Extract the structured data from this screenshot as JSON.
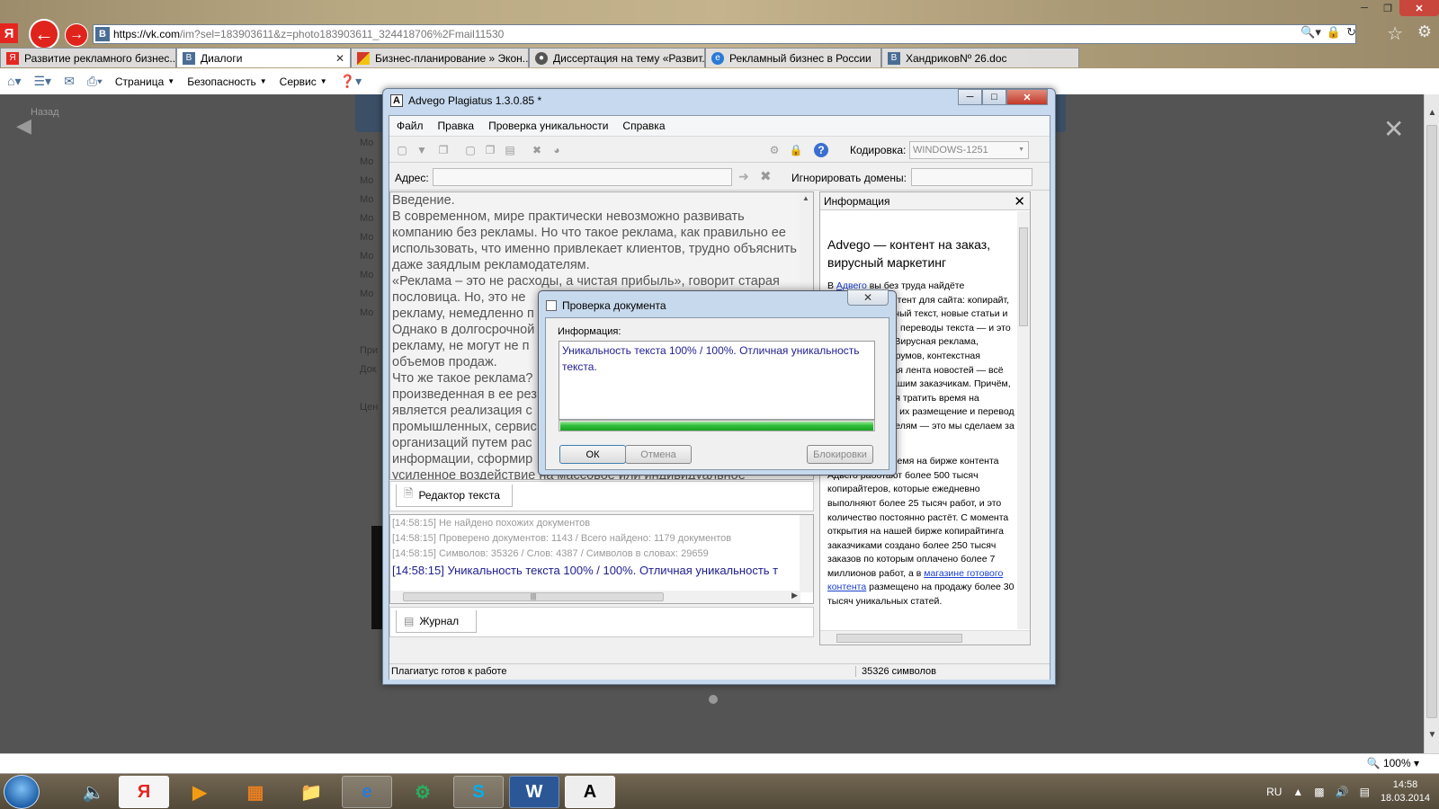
{
  "browser": {
    "url_main": "https://vk.com",
    "url_rest": "/im?sel=183903611&z=photo183903611_324418706%2Fmail11530",
    "tabs": [
      {
        "label": "Развитие рекламного бизнес...",
        "active": false,
        "icon": "yandex-icon",
        "color": "#e52620"
      },
      {
        "label": "Диалоги",
        "active": true,
        "icon": "vk-icon",
        "color": "#4a6d95"
      },
      {
        "label": "Бизнес-планирование » Экон...",
        "active": false,
        "icon": "flag-icon",
        "color": "#d43a2a"
      },
      {
        "label": "Диссертация на тему «Развит...",
        "active": false,
        "icon": "globe-icon",
        "color": "#555555"
      },
      {
        "label": "Рекламный бизнес в России",
        "active": false,
        "icon": "ie-icon",
        "color": "#2a7ad6"
      },
      {
        "label": "ХандриковNº 26.doc",
        "active": false,
        "icon": "vk-icon",
        "color": "#4a6d95"
      }
    ],
    "commands": {
      "page": "Страница",
      "security": "Безопасность",
      "service": "Сервис"
    },
    "zoom": "100%"
  },
  "vk_page": {
    "back": "Назад",
    "sidebar": [
      "Мо",
      "Мо",
      "Мо",
      "Мо",
      "Мо",
      "Мо",
      "Мо",
      "Мо",
      "Мо",
      "Мо",
      "",
      "При",
      "Док",
      "",
      "Цен"
    ]
  },
  "advego": {
    "title": "Advego Plagiatus 1.3.0.85 *",
    "menu": [
      "Файл",
      "Правка",
      "Проверка уникальности",
      "Справка"
    ],
    "encoding_label": "Кодировка:",
    "encoding_value": "WINDOWS-1251",
    "address_label": "Адрес:",
    "ignore_label": "Игнорировать домены:",
    "editor_text": "Введение.\nВ современном, мире практически невозможно развивать компанию без рекламы. Но что такое реклама, как правильно ее использовать, что именно привлекает клиентов, трудно объяснить даже заядлым рекламодателям.\n«Реклама – это не расходы, а чистая прибыль», говорит старая пословица. Но, это не\nрекламу, немедленно п\nОднако в долгосрочной\nрекламу, не могут не п\nобъемов продаж.\nЧто же такое реклама?\nпроизведенная в ее рез\nявляется реализация с\nпромышленных, сервис\nорганизаций путем рас\nинформации, сформир\nусиленное воздействие на массовое или индивидуальное",
    "editor_tab": "Редактор текста",
    "log": [
      "[14:58:15] Не найдено похожих документов",
      "[14:58:15] Проверено документов: 1143  /  Всего найдено: 1179 документов",
      "[14:58:15] Символов: 35326 / Слов: 4387 / Символов в словах: 29659",
      "[14:58:15] Уникальность текста 100% / 100%. Отличная уникальность т"
    ],
    "journal_tab": "Журнал",
    "info": {
      "header": "Информация",
      "headline": "Advego — контент на заказ, вирусный маркетинг",
      "para1_link": "Адвего",
      "para1": "вы без труда найдёте уникальный контент для сайта: копирайт, рерайт, рекламный текст, новые статьи и статьи на заказ, переводы текста — и это далеко не всё! Вирусная реклама, наполнение форумов, контекстная реклама, готовая лента новостей — всё это доступно нашим заказчикам. Причём, вам не придётся тратить время на проверку работ, их размещение и перевод денег исполнителям — это мы сделаем за вас.",
      "para2_prefix": "В настоящее время на бирже контента Адвего работают более 500 тысяч копирайтеров, которые ежедневно выполняют более 25 тысяч работ, и это количество постоянно растёт. С момента открытия на нашей бирже копирайтинга заказчиками создано более 250 тысяч заказов по которым оплачено более 7 миллионов работ, а в",
      "para2_link": "магазине готового контента",
      "para2_suffix": "размещено на продажу более 30 тысяч уникальных статей."
    },
    "status_left": "Плагиатус готов к работе",
    "status_right": "35326 символов"
  },
  "dialog": {
    "title": "Проверка документа",
    "group_label": "Информация:",
    "message": "Уникальность текста 100% / 100%. Отличная уникальность текста.",
    "progress_fraction": 1.0,
    "ok": "ОК",
    "cancel": "Отмена",
    "block": "Блокировки"
  },
  "taskbar": {
    "lang": "RU",
    "time": "14:58",
    "date": "18.03.2014"
  }
}
